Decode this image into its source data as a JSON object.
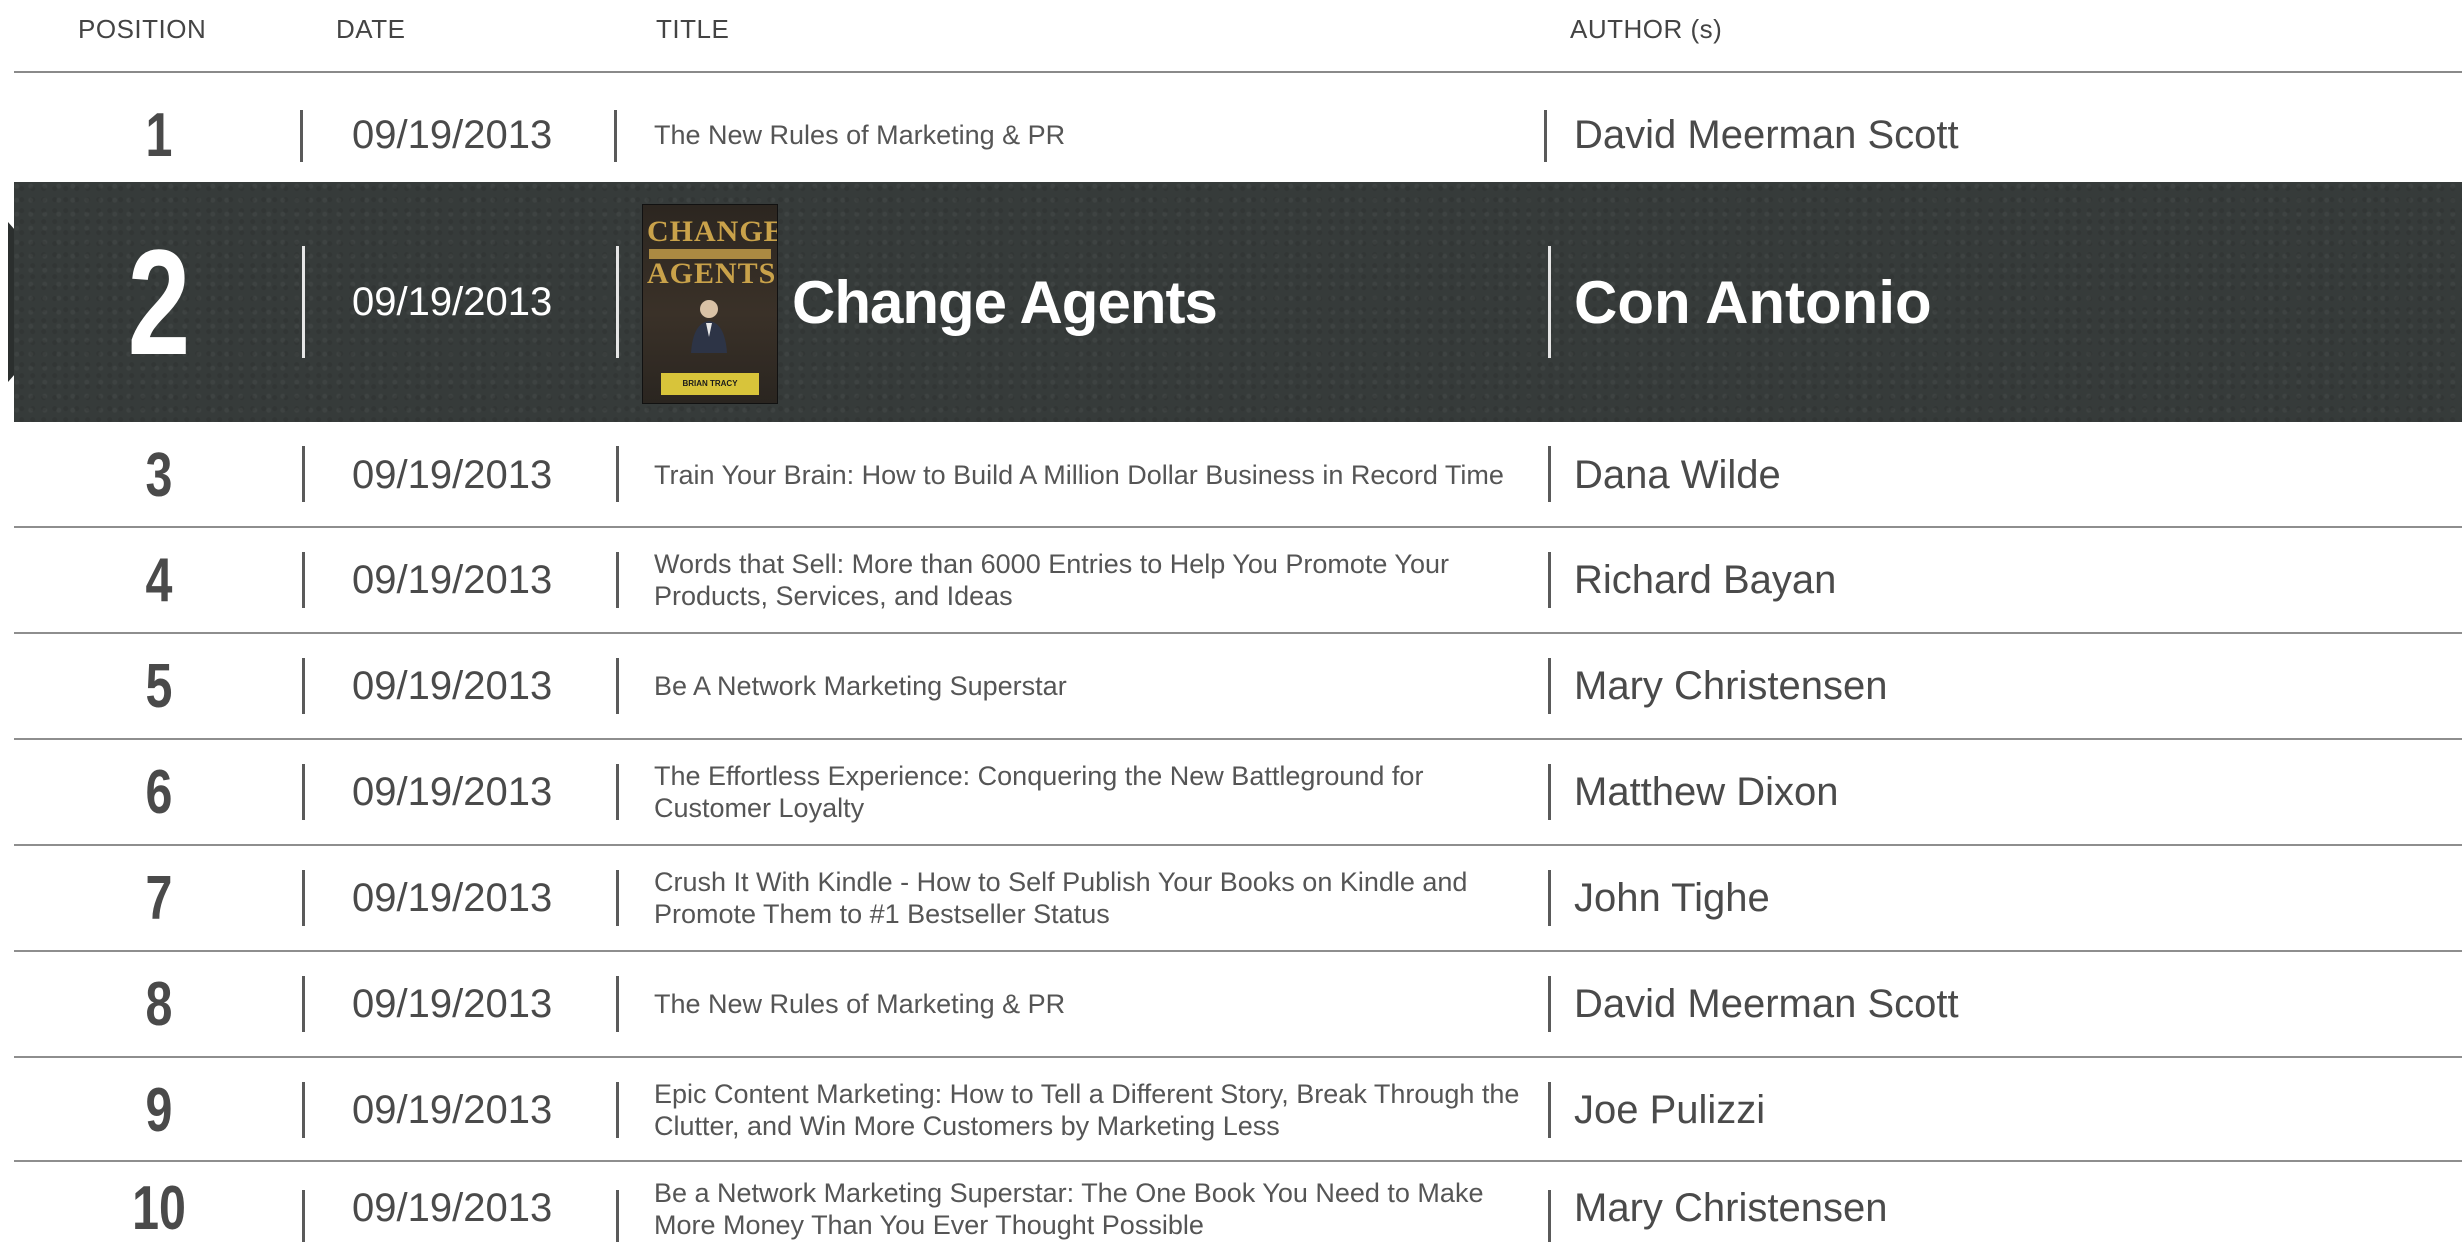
{
  "header": {
    "position": "POSITION",
    "date": "DATE",
    "title": "TITLE",
    "author": "AUTHOR (s)"
  },
  "rows": [
    {
      "position": "1",
      "date": "09/19/2013",
      "title": "The New Rules of Marketing & PR",
      "author": "David Meerman Scott"
    },
    {
      "position": "2",
      "date": "09/19/2013",
      "title": "Change Agents",
      "author": "Con Antonio",
      "highlighted": true
    },
    {
      "position": "3",
      "date": "09/19/2013",
      "title": "Train Your Brain: How to Build A Million Dollar Business in Record Time",
      "author": "Dana Wilde"
    },
    {
      "position": "4",
      "date": "09/19/2013",
      "title": "Words that Sell: More than 6000 Entries to Help You Promote Your Products, Services, and Ideas",
      "author": "Richard Bayan"
    },
    {
      "position": "5",
      "date": "09/19/2013",
      "title": "Be A Network Marketing Superstar",
      "author": "Mary Christensen"
    },
    {
      "position": "6",
      "date": "09/19/2013",
      "title": "The Effortless Experience: Conquering the New Battleground for Customer Loyalty",
      "author": "Matthew Dixon"
    },
    {
      "position": "7",
      "date": "09/19/2013",
      "title": "Crush It With Kindle - How to Self Publish Your Books on Kindle and Promote Them to #1 Bestseller Status",
      "author": "John Tighe"
    },
    {
      "position": "8",
      "date": "09/19/2013",
      "title": "The New Rules of Marketing & PR",
      "author": "David Meerman Scott"
    },
    {
      "position": "9",
      "date": "09/19/2013",
      "title": "Epic Content Marketing: How to Tell a Different Story, Break Through the Clutter, and Win More Customers by Marketing Less",
      "author": "Joe Pulizzi"
    },
    {
      "position": "10",
      "date": "09/19/2013",
      "title": "Be a Network Marketing Superstar: The One Book You Need to Make More Money Than You Ever Thought Possible",
      "author": "Mary Christensen"
    }
  ],
  "cover": {
    "line1": "CHANGE",
    "line2": "AGENTS",
    "plate": "BRIAN TRACY"
  },
  "colors": {
    "highlight_bg": "#363b3a",
    "rule": "#8e8e8e",
    "text": "#4a4a4a"
  }
}
